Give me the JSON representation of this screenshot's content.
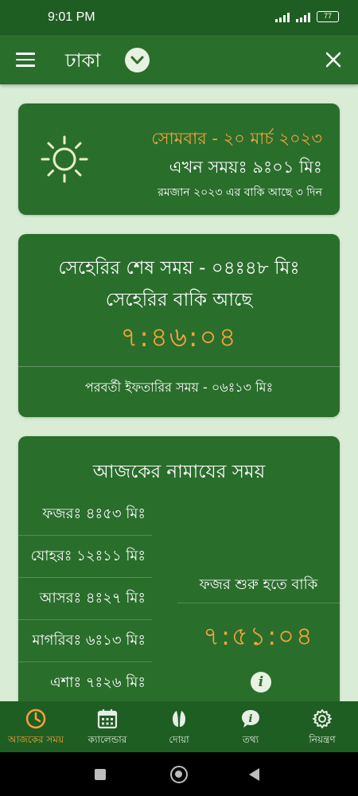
{
  "status": {
    "time": "9:01 PM",
    "battery": "77"
  },
  "header": {
    "city": "ঢাকা"
  },
  "today": {
    "date": "সোমবার - ২০ মার্চ ২০২৩",
    "current_time": "এখন সময়ঃ ৯ঃ০১ মিঃ",
    "ramadan": "রমজান ২০২৩ এর বাকি আছে ৩ দিন"
  },
  "sehri": {
    "end_time": "সেহেরির শেষ সময় - ০৪ঃ৪৮ মিঃ",
    "remaining_label": "সেহেরির বাকি আছে",
    "countdown": "৭:৪৬:০৪",
    "next_iftar": "পরবর্তী ইফতারির সময় - ০৬ঃ১৩ মিঃ"
  },
  "prayers": {
    "title": "আজকের নামাযের সময়",
    "items": [
      {
        "label": "ফজরঃ ৪ঃ৫৩ মিঃ"
      },
      {
        "label": "যোহরঃ ১২ঃ১১ মিঃ"
      },
      {
        "label": "আসরঃ ৪ঃ২৭ মিঃ"
      },
      {
        "label": "মাগরিবঃ ৬ঃ১৩ মিঃ"
      },
      {
        "label": "এশাঃ ৭ঃ২৬ মিঃ"
      }
    ],
    "fajr_remaining": "ফজর শুরু হতে বাকি",
    "fajr_countdown": "৭:৫১:০৪",
    "info_glyph": "i"
  },
  "nav": {
    "items": [
      {
        "label": "আজকের সময়",
        "icon": "clock-icon",
        "active": true
      },
      {
        "label": "ক্যালেন্ডার",
        "icon": "calendar-icon"
      },
      {
        "label": "দোয়া",
        "icon": "praying-hands-icon"
      },
      {
        "label": "তথ্য",
        "icon": "info-bubble-icon"
      },
      {
        "label": "নিয়ন্ত্রণ",
        "icon": "gear-icon"
      }
    ]
  },
  "colors": {
    "primary": "#2a6e2c",
    "dark": "#1f5e22",
    "accent": "#f3a33a",
    "background": "#d9ecd6"
  }
}
